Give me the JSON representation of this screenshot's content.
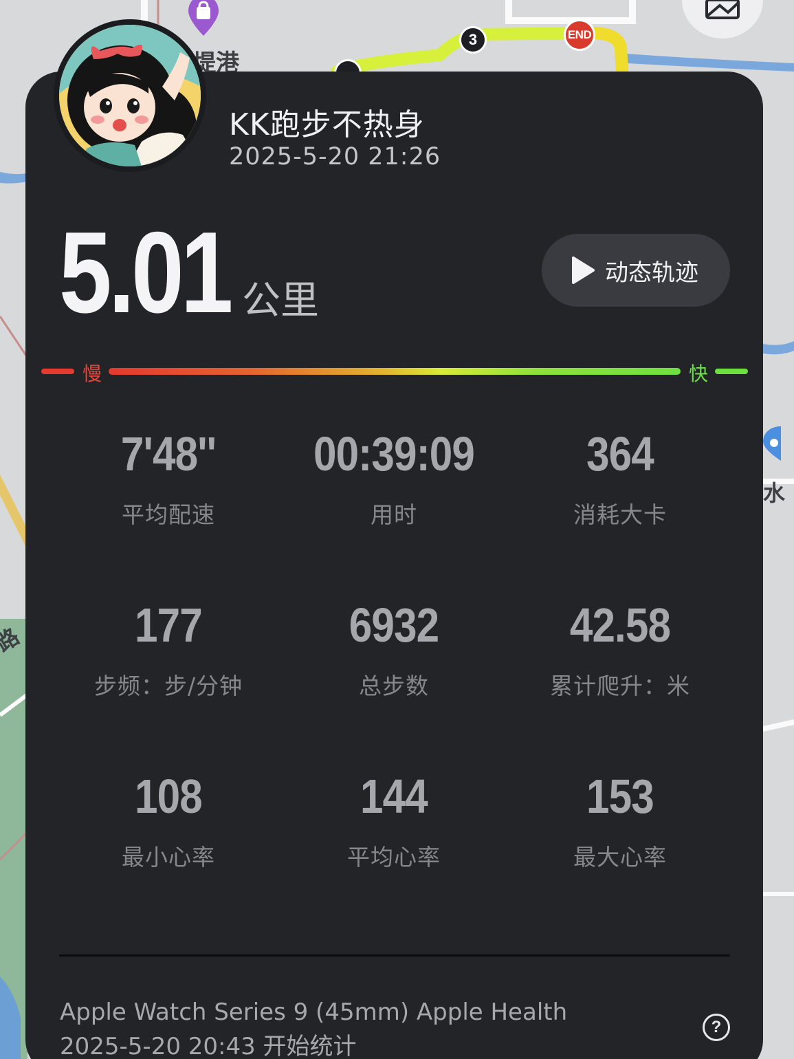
{
  "map": {
    "labels": [
      "堤港",
      "路",
      "水"
    ],
    "markers": {
      "km": "3",
      "end": "END"
    },
    "route_colors": [
      "#c8f23a",
      "#ecef3a",
      "#f2e62e"
    ]
  },
  "header": {
    "username": "KK跑步不热身",
    "datetime": "2025-5-20 21:26"
  },
  "summary": {
    "distance": "5.01",
    "unit": "公里",
    "track_button_label": "动态轨迹"
  },
  "pace_legend": {
    "slow": "慢",
    "fast": "快",
    "slow_color": "#e53a2f",
    "fast_color": "#6de040"
  },
  "stats": [
    {
      "value": "7'48''",
      "label": "平均配速"
    },
    {
      "value": "00:39:09",
      "label": "用时"
    },
    {
      "value": "364",
      "label": "消耗大卡"
    },
    {
      "value": "177",
      "label": "步频：步/分钟"
    },
    {
      "value": "6932",
      "label": "总步数"
    },
    {
      "value": "42.58",
      "label": "累计爬升：米"
    },
    {
      "value": "108",
      "label": "最小心率"
    },
    {
      "value": "144",
      "label": "平均心率"
    },
    {
      "value": "153",
      "label": "最大心率"
    }
  ],
  "footer": {
    "device": "Apple Watch Series 9 (45mm) Apple Health",
    "start": "2025-5-20 20:43 开始统计",
    "help_icon": "question-circle-icon"
  },
  "icons": {
    "play": "play-icon",
    "map_toggle": "map-layer-icon",
    "poi": "shopping-bag-icon"
  }
}
